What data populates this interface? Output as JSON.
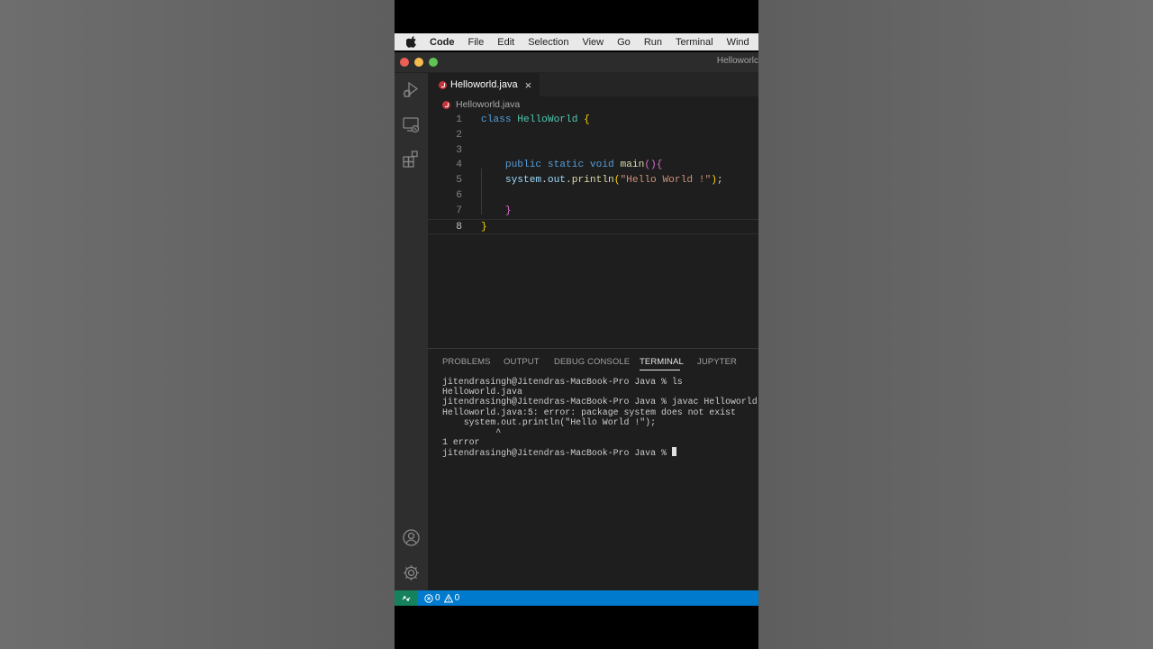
{
  "menubar": {
    "app_name": "Code",
    "items": [
      "File",
      "Edit",
      "Selection",
      "View",
      "Go",
      "Run",
      "Terminal",
      "Wind"
    ]
  },
  "window": {
    "title": "Helloworlc"
  },
  "activity_bar": {
    "icons": [
      "run-debug-icon",
      "remote-explorer-icon",
      "extensions-icon",
      "account-icon",
      "settings-gear-icon"
    ]
  },
  "tabs": [
    {
      "label": "Helloworld.java",
      "close_glyph": "×"
    }
  ],
  "breadcrumb": "Helloworld.java",
  "editor": {
    "lines": [
      {
        "n": "1",
        "tokens": [
          [
            "kw",
            "class"
          ],
          [
            "txt",
            " "
          ],
          [
            "cls",
            "HelloWorld"
          ],
          [
            "txt",
            " "
          ],
          [
            "br1",
            "{"
          ]
        ]
      },
      {
        "n": "2",
        "tokens": []
      },
      {
        "n": "3",
        "tokens": []
      },
      {
        "n": "4",
        "tokens": [
          [
            "txt",
            "    "
          ],
          [
            "kw",
            "public"
          ],
          [
            "txt",
            " "
          ],
          [
            "kw",
            "static"
          ],
          [
            "txt",
            " "
          ],
          [
            "kw",
            "void"
          ],
          [
            "txt",
            " "
          ],
          [
            "fn",
            "main"
          ],
          [
            "br2",
            "()"
          ],
          [
            "br2",
            "{"
          ]
        ]
      },
      {
        "n": "5",
        "tokens": [
          [
            "txt",
            "    "
          ],
          [
            "var",
            "system"
          ],
          [
            "txt",
            "."
          ],
          [
            "var",
            "out"
          ],
          [
            "txt",
            "."
          ],
          [
            "fn",
            "println"
          ],
          [
            "br1",
            "("
          ],
          [
            "str",
            "\"Hello World !\""
          ],
          [
            "br1",
            ")"
          ],
          [
            "txt",
            ";"
          ]
        ]
      },
      {
        "n": "6",
        "tokens": []
      },
      {
        "n": "7",
        "tokens": [
          [
            "txt",
            "    "
          ],
          [
            "br2",
            "}"
          ]
        ]
      },
      {
        "n": "8",
        "tokens": [
          [
            "br1",
            "}"
          ]
        ]
      }
    ],
    "active_line": "8"
  },
  "panel": {
    "tabs": [
      "PROBLEMS",
      "OUTPUT",
      "DEBUG CONSOLE",
      "TERMINAL",
      "JUPYTER"
    ],
    "active_tab": "TERMINAL"
  },
  "terminal": {
    "lines": [
      "jitendrasingh@Jitendras-MacBook-Pro Java % ls",
      "Helloworld.java",
      "jitendrasingh@Jitendras-MacBook-Pro Java % javac Helloworld.java",
      "Helloworld.java:5: error: package system does not exist",
      "    system.out.println(\"Hello World !\");",
      "          ^",
      "1 error"
    ],
    "prompt": "jitendrasingh@Jitendras-MacBook-Pro Java % "
  },
  "statusbar": {
    "errors": "0",
    "warnings": "0",
    "remote_color": "#16825d",
    "bar_color": "#007acc"
  }
}
